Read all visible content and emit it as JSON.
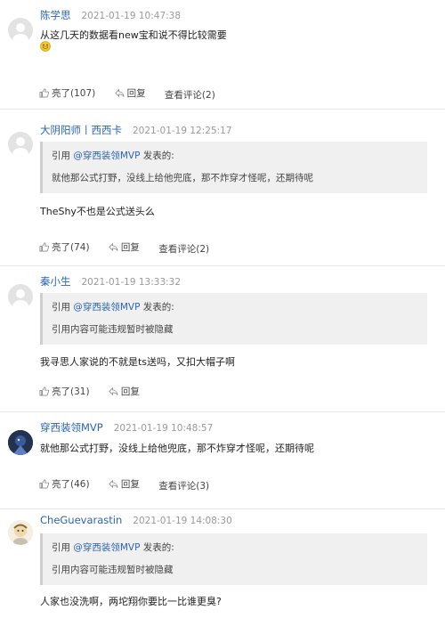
{
  "comments": [
    {
      "user": "陈学思",
      "time": "2021-01-19 10:47:38",
      "text": "从这几天的数据看new宝和说不得比较需要",
      "likes_label": "亮了(107)",
      "reply_label": "回复",
      "view_label": "查看评论(2)"
    },
    {
      "user": "大阴阳师丨西西卡",
      "time": "2021-01-19 12:25:17",
      "quote_prefix": "引用 ",
      "quote_user": "@穿西装领MVP",
      "quote_suffix": " 发表的:",
      "quote_text": "就他那公式打野，没线上给他兜底，那不炸穿才怪呢，还期待呢",
      "text": "TheShy不也是公式送头么",
      "likes_label": "亮了(74)",
      "reply_label": "回复",
      "view_label": "查看评论(2)"
    },
    {
      "user": "秦小生",
      "time": "2021-01-19 13:33:32",
      "quote_prefix": "引用 ",
      "quote_user": "@穿西装领MVP",
      "quote_suffix": " 发表的:",
      "quote_text": "引用内容可能违规暂时被隐藏",
      "text": "我寻思人家说的不就是ts送吗，又扣大帽子啊",
      "likes_label": "亮了(31)",
      "reply_label": "回复"
    },
    {
      "user": "穿西装领MVP",
      "time": "2021-01-19 10:48:57",
      "text": "就他那公式打野，没线上给他兜底，那不炸穿才怪呢，还期待呢",
      "likes_label": "亮了(46)",
      "reply_label": "回复",
      "view_label": "查看评论(3)"
    },
    {
      "user": "CheGuevarastin",
      "time": "2021-01-19 14:08:30",
      "quote_prefix": "引用 ",
      "quote_user": "@穿西装领MVP",
      "quote_suffix": " 发表的:",
      "quote_text": "引用内容可能违规暂时被隐藏",
      "text": "人家也没洗啊，两坨翔你要比一比谁更臭?"
    }
  ],
  "colors": {
    "username": "#2b65b3",
    "timestamp": "#9a9a9a",
    "quote_bg": "#f0f0f0"
  },
  "icons": {
    "like": "thumbs-up-icon",
    "reply": "reply-arrow-icon",
    "emoji": "grin-emoji-icon"
  }
}
